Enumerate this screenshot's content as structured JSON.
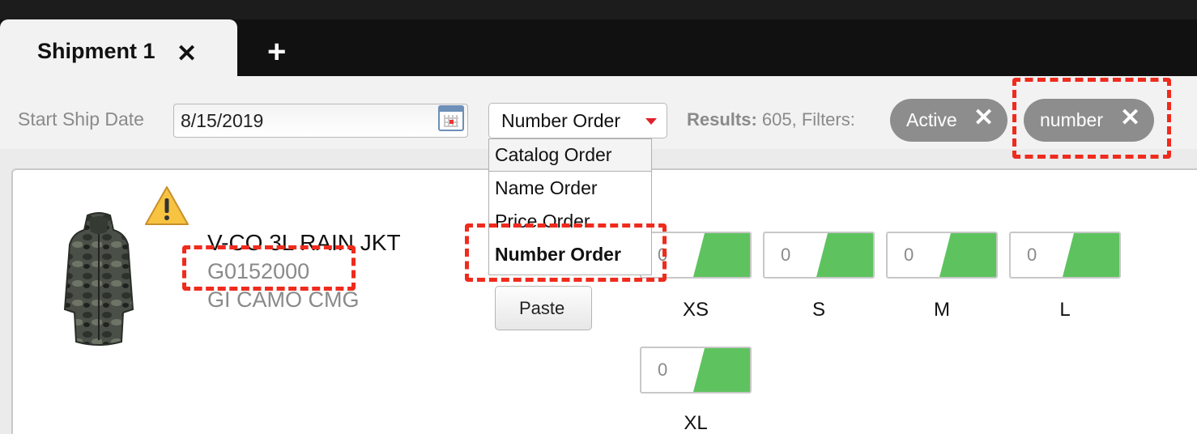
{
  "tabs": [
    {
      "label": "Shipment 1",
      "close_glyph": "✕"
    }
  ],
  "add_tab_glyph": "+",
  "filters": {
    "start_ship_date_label": "Start Ship Date",
    "start_ship_date_value": "8/15/2019",
    "sort_selected": "Number Order",
    "results_label": "Results:",
    "results_count": "605, Filters:",
    "chips": [
      {
        "label": "Active",
        "remove_glyph": "✕"
      },
      {
        "label": "number",
        "remove_glyph": "✕"
      }
    ]
  },
  "sort_options": [
    "Catalog Order",
    "Name Order",
    "Price Order",
    "Number Order"
  ],
  "product": {
    "name": "V-CO 3L RAIN JKT",
    "number": "G0152000",
    "color": "GI CAMO CMG",
    "paste_label": "Paste",
    "sizes": [
      {
        "label": "XS",
        "qty": "0"
      },
      {
        "label": "S",
        "qty": "0"
      },
      {
        "label": "M",
        "qty": "0"
      },
      {
        "label": "L",
        "qty": "0"
      },
      {
        "label": "XL",
        "qty": "0"
      }
    ]
  },
  "icons": {
    "calendar": "calendar-icon",
    "warning": "warning-icon",
    "dropdown_caret": "caret-down-icon"
  },
  "colors": {
    "qty_fill": "#5ec35e",
    "chip_bg": "#8d8d8d",
    "highlight": "#ef2b1e",
    "caret": "#e0202a"
  }
}
